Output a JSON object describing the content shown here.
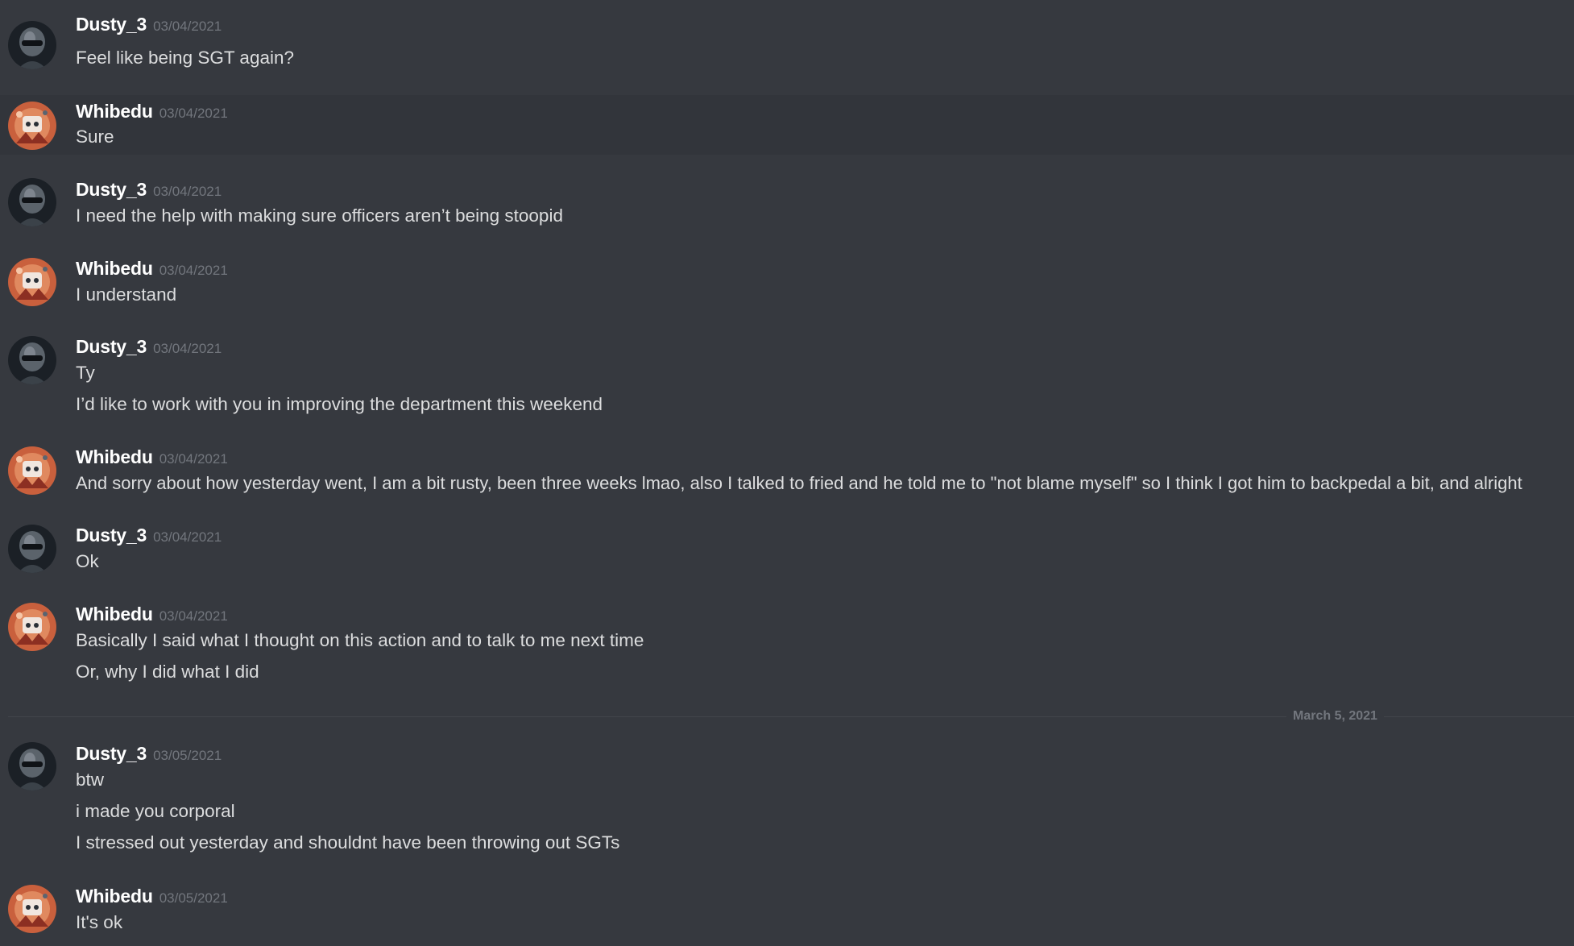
{
  "colors": {
    "background": "#36393f",
    "hover_row": "#32353b",
    "author": "#ffffff",
    "timestamp": "#72767d",
    "message_text": "#dcddde",
    "divider": "#42454a"
  },
  "messages": [
    {
      "author": "Dusty_3",
      "avatar": "dusty-avatar-icon",
      "timestamp": "03/04/2021",
      "lines": [
        "Feel like being SGT again?"
      ]
    },
    {
      "author": "Whibedu",
      "avatar": "whibedu-avatar-icon",
      "timestamp": "03/04/2021",
      "lines": [
        "Sure"
      ]
    },
    {
      "author": "Dusty_3",
      "avatar": "dusty-avatar-icon",
      "timestamp": "03/04/2021",
      "lines": [
        "I need the help with making sure officers aren’t being stoopid"
      ]
    },
    {
      "author": "Whibedu",
      "avatar": "whibedu-avatar-icon",
      "timestamp": "03/04/2021",
      "lines": [
        "I understand"
      ]
    },
    {
      "author": "Dusty_3",
      "avatar": "dusty-avatar-icon",
      "timestamp": "03/04/2021",
      "lines": [
        "Ty",
        "I’d like to work with you in improving the department this weekend"
      ]
    },
    {
      "author": "Whibedu",
      "avatar": "whibedu-avatar-icon",
      "timestamp": "03/04/2021",
      "lines": [
        "And sorry about how yesterday went, I am a bit rusty, been three weeks lmao, also I talked to fried and he told me to \"not blame myself\" so I think I got him to backpedal a bit, and alright"
      ]
    },
    {
      "author": "Dusty_3",
      "avatar": "dusty-avatar-icon",
      "timestamp": "03/04/2021",
      "lines": [
        "Ok"
      ]
    },
    {
      "author": "Whibedu",
      "avatar": "whibedu-avatar-icon",
      "timestamp": "03/04/2021",
      "lines": [
        "Basically I said what I thought on this action and to talk to me next time",
        "Or, why I did what I did"
      ]
    },
    {
      "author": "Dusty_3",
      "avatar": "dusty-avatar-icon",
      "timestamp": "03/05/2021",
      "lines": [
        "btw",
        "i made you corporal",
        "I stressed out yesterday and shouldnt have been throwing out SGTs"
      ]
    },
    {
      "author": "Whibedu",
      "avatar": "whibedu-avatar-icon",
      "timestamp": "03/05/2021",
      "lines": [
        "It's ok"
      ]
    }
  ],
  "date_divider": "March 5, 2021"
}
